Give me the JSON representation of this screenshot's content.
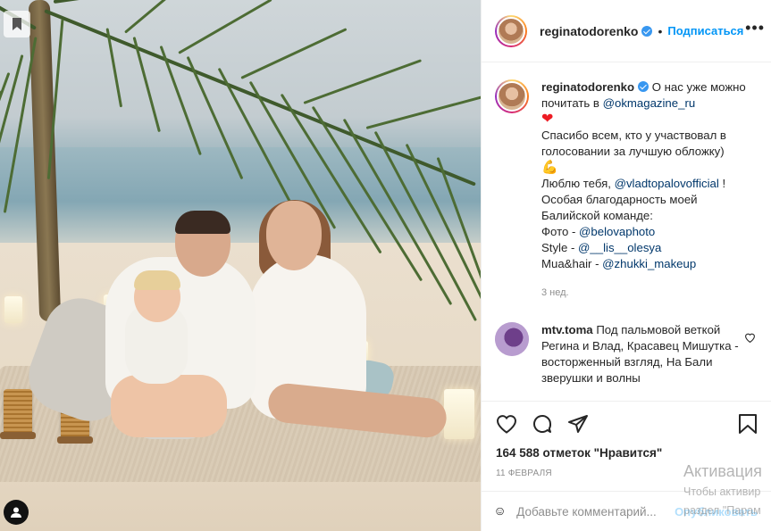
{
  "header": {
    "username": "reginatodorenko",
    "separator": "•",
    "follow_label": "Подписаться",
    "more_label": "•••"
  },
  "caption": {
    "username": "reginatodorenko",
    "line1": "О нас уже можно почитать в ",
    "mention1": "@okmagazine_ru",
    "heart": "❤",
    "line2": "Спасибо всем, кто у участвовал в голосовании за лучшую обложку)",
    "muscle": "💪",
    "line3_pre": "Люблю тебя, ",
    "mention2": "@vladtopalovofficial",
    "line3_post": " !",
    "line4": "Особая благодарность моей Балийской команде:",
    "photo_label": "Фото - ",
    "mention3": "@belovaphoto",
    "style_label": "Style - ",
    "mention4": "@__lis__olesya",
    "mua_label": "Mua&hair - ",
    "mention5": "@zhukki_makeup",
    "time": "3 нед."
  },
  "comment": {
    "username": "mtv.toma",
    "text": "Под пальмовой веткой Регина и Влад, Красавец Мишутка - восторженный взгляд, На Бали зверушки и волны"
  },
  "likes": "164 588 отметок \"Нравится\"",
  "date": "11 ФЕВРАЛЯ",
  "add_comment": {
    "placeholder": "Добавьте комментарий...",
    "publish": "Опубликовать"
  },
  "watermark": {
    "title": "Активация",
    "line1": "Чтобы активир",
    "line2": "раздел \"Парам"
  },
  "colors": {
    "follow": "#0095f6",
    "link": "#00376b",
    "verified": "#3897f0",
    "heart": "#ed1c24"
  }
}
